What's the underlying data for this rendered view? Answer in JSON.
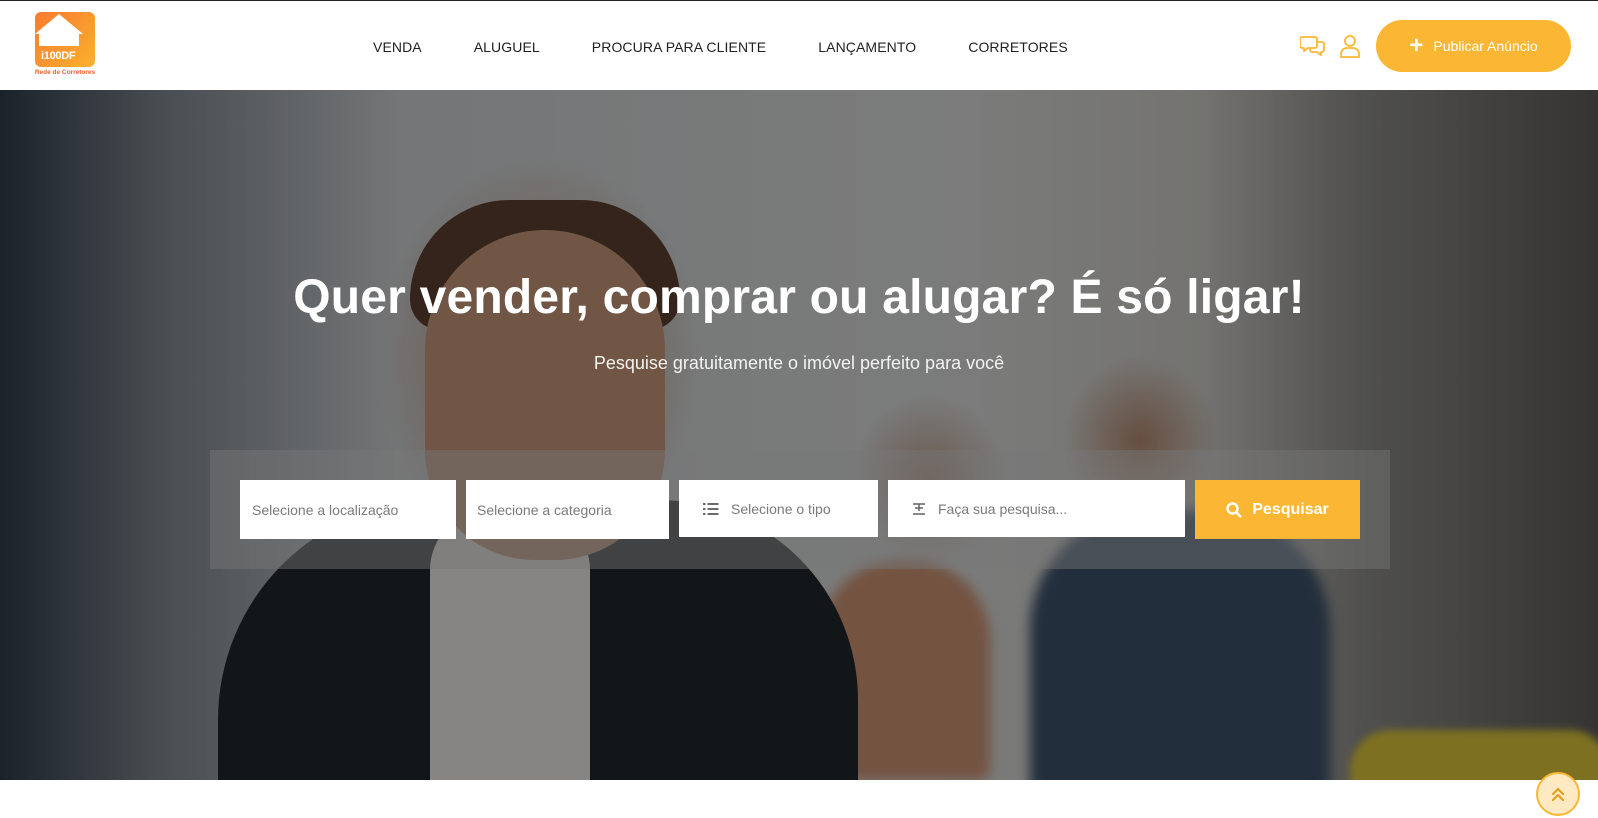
{
  "brand": {
    "logo_text_1": "i100",
    "logo_text_2": "DF",
    "logo_subtitle": "Rede de Corretores",
    "accent_color": "#fbb733",
    "brand_orange": "#f97a2f"
  },
  "nav": {
    "items": [
      {
        "label": "VENDA"
      },
      {
        "label": "ALUGUEL"
      },
      {
        "label": "PROCURA PARA CLIENTE"
      },
      {
        "label": "LANÇAMENTO"
      },
      {
        "label": "CORRETORES"
      }
    ]
  },
  "header": {
    "chat_icon": "chat-bubbles-icon",
    "user_icon": "user-icon",
    "publish_label": "Publicar Anúncio"
  },
  "hero": {
    "title": "Quer vender, comprar ou alugar? É só ligar!",
    "subtitle": "Pesquise gratuitamente o imóvel perfeito para você"
  },
  "search": {
    "location_placeholder": "Selecione a localização",
    "category_placeholder": "Selecione a categoria",
    "type_placeholder": "Selecione o tipo",
    "query_placeholder": "Faça sua pesquisa...",
    "button_label": "Pesquisar"
  },
  "scroll_top": {
    "icon": "double-chevron-up-icon"
  }
}
